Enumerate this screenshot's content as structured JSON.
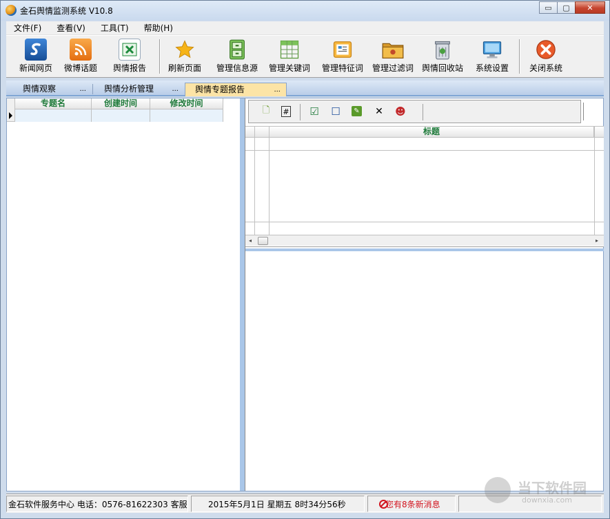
{
  "window": {
    "title": "金石舆情监测系统 V10.8",
    "controls": {
      "minimize": "▭",
      "maximize": "▢",
      "close": "✕"
    }
  },
  "menu": [
    "文件(F)",
    "查看(V)",
    "工具(T)",
    "帮助(H)"
  ],
  "toolbar": [
    {
      "label": "新闻网页",
      "icon": "news-web-icon",
      "color": "#1f63b5"
    },
    {
      "label": "微博话题",
      "icon": "rss-icon",
      "color": "#f28a1c"
    },
    {
      "label": "舆情报告",
      "icon": "excel-icon",
      "color": "#1c8a3c"
    },
    {
      "label": "刷新页面",
      "icon": "star-icon",
      "color": "#f6b417"
    },
    {
      "label": "管理信息源",
      "icon": "cabinet-icon",
      "color": "#5aa840"
    },
    {
      "label": "管理关键词",
      "icon": "table-icon",
      "color": "#5a9a3a"
    },
    {
      "label": "管理特征词",
      "icon": "image-card-icon",
      "color": "#f0a830"
    },
    {
      "label": "管理过滤词",
      "icon": "folder-icon",
      "color": "#c88a1c"
    },
    {
      "label": "舆情回收站",
      "icon": "recycle-bin-icon",
      "color": "#8a8a8a"
    },
    {
      "label": "系统设置",
      "icon": "monitor-icon",
      "color": "#3a8ad0"
    },
    {
      "label": "关闭系统",
      "icon": "close-circle-icon",
      "color": "#e0502a"
    }
  ],
  "tabs": [
    {
      "label": "舆情观察",
      "more": "..."
    },
    {
      "label": "舆情分析管理",
      "more": "..."
    },
    {
      "label": "舆情专题报告",
      "more": "...",
      "active": true
    }
  ],
  "left_grid": {
    "columns": [
      "专题名",
      "创建时间",
      "修改时间"
    ]
  },
  "right_toolbar": [
    {
      "icon": "new-doc-icon",
      "glyph": "🗋"
    },
    {
      "icon": "hash-icon",
      "glyph": "#"
    },
    {
      "icon": "checkbox-checked-icon",
      "glyph": "☑"
    },
    {
      "icon": "checkbox-empty-icon",
      "glyph": "☐"
    },
    {
      "icon": "edit-icon",
      "glyph": "✎"
    },
    {
      "icon": "delete-x-icon",
      "glyph": "✕"
    },
    {
      "icon": "face-icon",
      "glyph": "☻"
    }
  ],
  "right_grid": {
    "columns": [
      "标题"
    ],
    "scroll_left": "◂",
    "scroll_right": "▸"
  },
  "statusbar": {
    "service": "金石软件服务中心 电话：0576-81622303  客服",
    "datetime": "2015年5月1日   星期五    8时34分56秒",
    "alert": "您有8条新消息"
  },
  "watermark": {
    "title": "当下软件园",
    "url": "downxia.com"
  },
  "colors": {
    "header_text": "#1e7a3a",
    "accent_tab": "#fce4a6",
    "splitter": "#a9c6e8",
    "alert": "#d2141e"
  }
}
